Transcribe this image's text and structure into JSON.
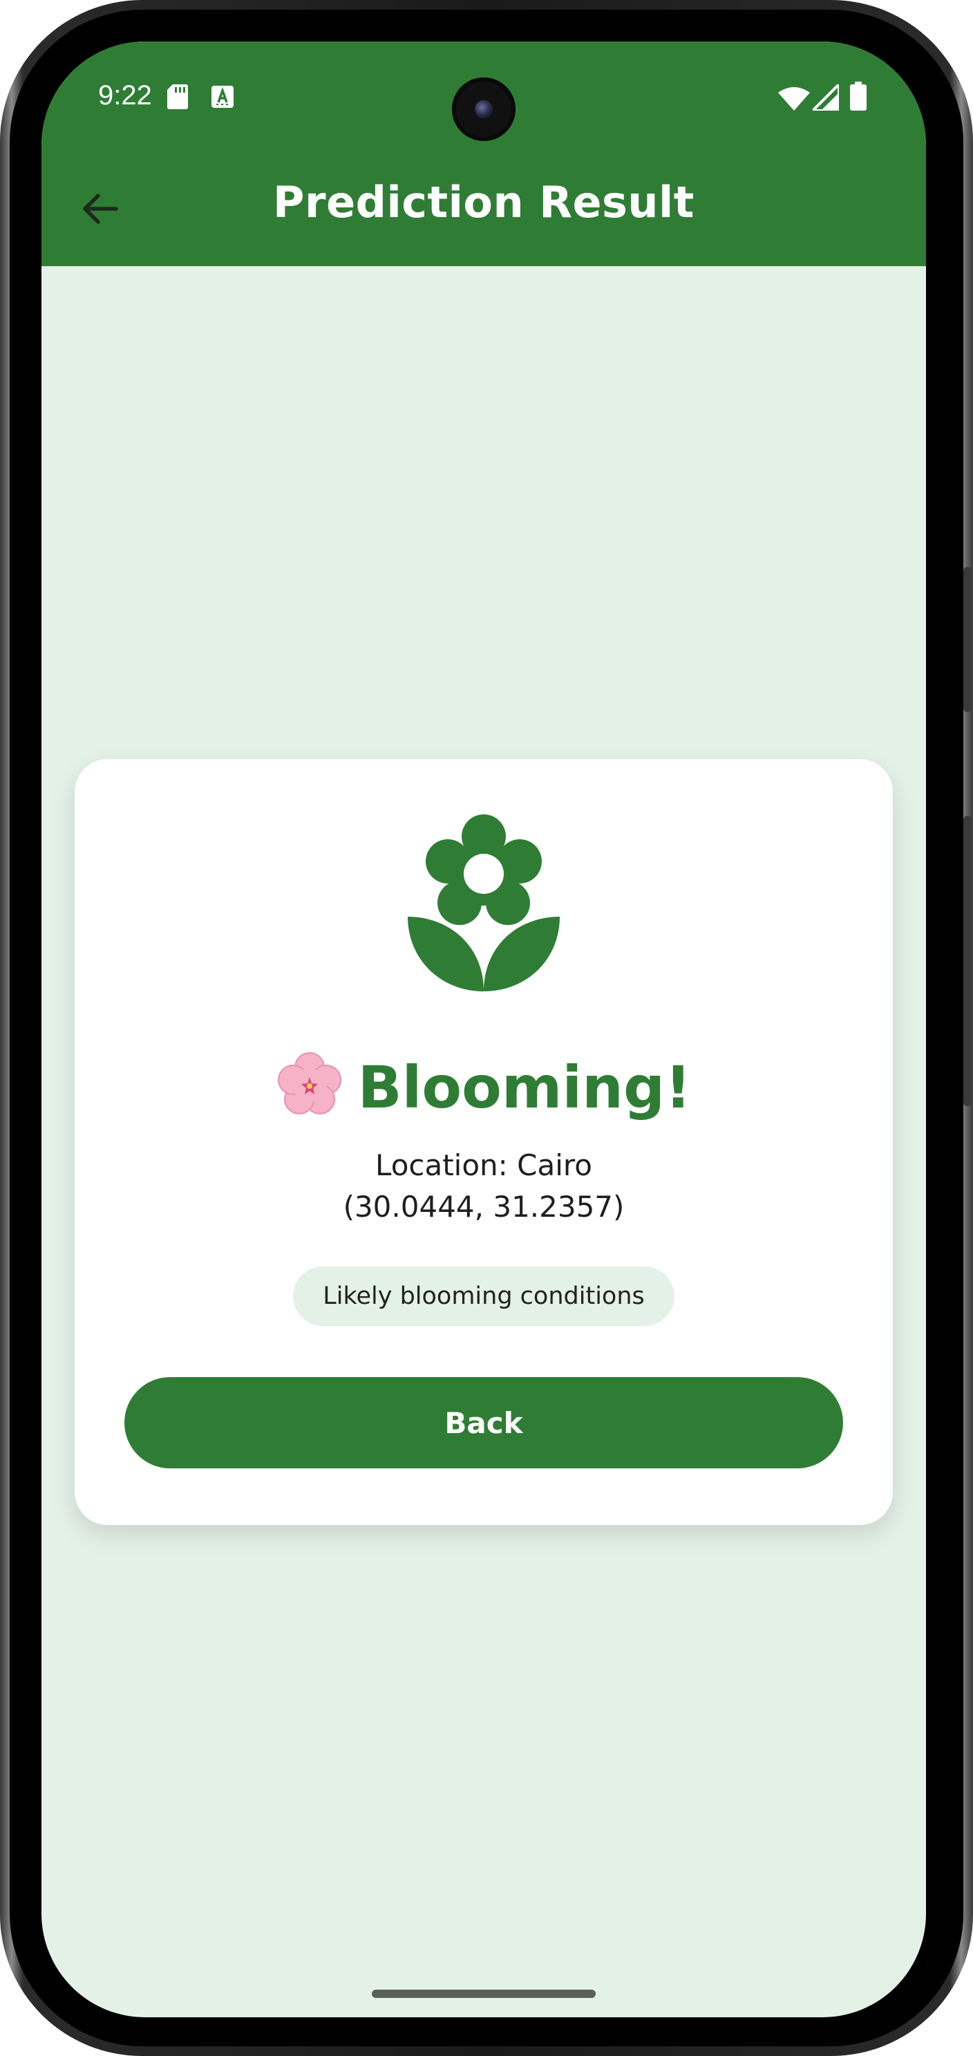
{
  "status_bar": {
    "time": "9:22",
    "icons": [
      "sd-card-icon",
      "keyboard-a-icon",
      "wifi-icon",
      "signal-icon",
      "battery-icon"
    ]
  },
  "app_bar": {
    "title": "Prediction Result",
    "back_icon": "arrow-left-icon"
  },
  "result": {
    "icon": "flower-icon",
    "emoji": "cherry-blossom-emoji",
    "headline": "Blooming!",
    "location_line": "Location: Cairo",
    "coordinates_line": "(30.0444, 31.2357)",
    "chip_text": "Likely blooming conditions",
    "back_button_label": "Back"
  },
  "colors": {
    "primary": "#2f7d35",
    "background": "#e4f1e7",
    "card": "#ffffff",
    "chip": "#e4f1e7"
  }
}
